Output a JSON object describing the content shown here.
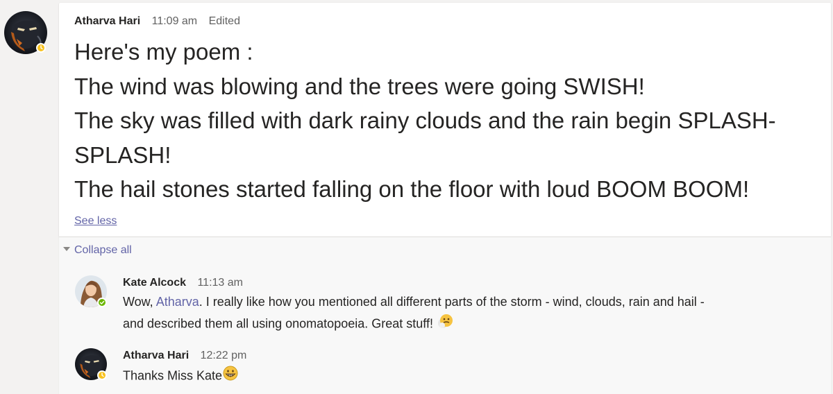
{
  "post": {
    "author": "Atharva Hari",
    "time": "11:09 am",
    "edited": "Edited",
    "poem_lines": [
      "Here's my poem :",
      "The wind was blowing and the trees were going SWISH!",
      "The sky was filled with dark rainy clouds and the rain begin SPLASH-",
      "SPLASH!",
      "The hail stones started falling on the floor with loud BOOM BOOM!"
    ],
    "see_less": "See less",
    "presence": "away",
    "avatar_icon": "atharva-avatar-icon"
  },
  "replies": {
    "collapse_all": "Collapse all",
    "items": [
      {
        "author": "Kate Alcock",
        "time": "11:13 am",
        "text_before_mention": "Wow, ",
        "mention": "Atharva",
        "text_line1_after": ". I really like how you mentioned all different parts of the storm - wind, clouds, rain and hail -",
        "text_line2": "and described them all using onomatopoeia. Great stuff!",
        "emoji": "thinking-face-emoji",
        "presence": "available"
      },
      {
        "author": "Atharva Hari",
        "time": "12:22 pm",
        "text": "Thanks Miss Kate",
        "emoji": "grinning-face-emoji",
        "presence": "away"
      }
    ]
  },
  "colors": {
    "accent": "#6264a7",
    "away": "#f8c21f",
    "available": "#6bb700",
    "background": "#f3f2f1"
  }
}
